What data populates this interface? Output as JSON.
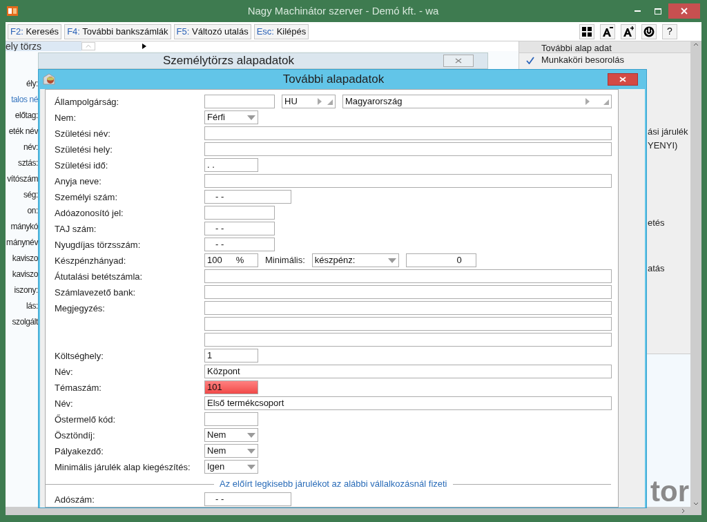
{
  "window": {
    "title": "Nagy Machinátor szerver - Demó kft. - wa"
  },
  "toolbar": [
    {
      "key": "F2:",
      "label": "Keresés"
    },
    {
      "key": "F4:",
      "label": "További bankszámlák"
    },
    {
      "key": "F5:",
      "label": "Változó utalás"
    },
    {
      "key": "Esc:",
      "label": "Kilépés"
    }
  ],
  "toolbar_icons": [
    {
      "kind": "grid"
    },
    {
      "kind": "smaller"
    },
    {
      "kind": "larger"
    },
    {
      "kind": "power"
    },
    {
      "kind": "help",
      "label": "?"
    }
  ],
  "background": {
    "tab": "ely törzs",
    "subwindow_title": "Személytörzs alapadatok",
    "labels": [
      {
        "text": "ély:",
        "kind": "plain"
      },
      {
        "text": "talos né",
        "kind": "link"
      },
      {
        "text": "előtag:",
        "kind": "plain"
      },
      {
        "text": "eték név",
        "kind": "plain"
      },
      {
        "text": "név:",
        "kind": "plain"
      },
      {
        "text": "sztás:",
        "kind": "plain"
      },
      {
        "text": "vítószám",
        "kind": "plain"
      },
      {
        "text": "ség:",
        "kind": "plain"
      },
      {
        "text": "on:",
        "kind": "plain"
      },
      {
        "text": "mánykó",
        "kind": "plain"
      },
      {
        "text": "mánynév",
        "kind": "plain"
      },
      {
        "text": "kaviszo",
        "kind": "plain"
      },
      {
        "text": "kaviszo",
        "kind": "plain"
      },
      {
        "text": "iszony:",
        "kind": "plain"
      },
      {
        "text": "lás:",
        "kind": "plain"
      },
      {
        "text": "szolgált",
        "kind": "plain"
      }
    ]
  },
  "side_panel": {
    "header": "További alap adat",
    "checked_item": {
      "text": "Munkaköri besorolás",
      "checked": true
    },
    "items": [
      {
        "text": "ási járulék"
      },
      {
        "text": "YENYI)"
      },
      {
        "text": "etés"
      },
      {
        "text": "atás"
      }
    ],
    "logo": "tor"
  },
  "dialog": {
    "title": "További alapadatok",
    "rows": [
      {
        "kind": "country",
        "label": "Állampolgárság:",
        "code": "HU",
        "country": "Magyarország",
        "invalid": false
      },
      {
        "kind": "select",
        "label": "Nem:",
        "value": "Férfi",
        "invalid": false
      },
      {
        "kind": "wide",
        "label": "Születési név:",
        "invalid": false
      },
      {
        "kind": "wide",
        "label": "Születési hely:",
        "invalid": false
      },
      {
        "kind": "short",
        "label": "Születési idő:",
        "value": ". .",
        "invalid": false
      },
      {
        "kind": "wide",
        "label": "Anyja neve:",
        "invalid": false
      },
      {
        "kind": "long",
        "label": "Személyi szám:",
        "value": "-      -",
        "invalid": false
      },
      {
        "kind": "medium",
        "label": "Adóazonosító jel:",
        "invalid": false
      },
      {
        "kind": "medium",
        "label": "TAJ szám:",
        "value": "-   -",
        "invalid": false
      },
      {
        "kind": "medium",
        "label": "Nyugdíjas törzsszám:",
        "value": "-    -",
        "invalid": false
      },
      {
        "kind": "cash",
        "label": "Készpénzhányad:",
        "value": "100",
        "unit": "%",
        "min_label": "Minimális:",
        "min_type": "készpénz:",
        "amount": "0",
        "invalid": false
      },
      {
        "kind": "wide",
        "label": "Átutalási betétszámla:",
        "invalid": false
      },
      {
        "kind": "wide",
        "label": "Számlavezető bank:",
        "invalid": false
      },
      {
        "kind": "wide",
        "label": "Megjegyzés:",
        "invalid": false
      },
      {
        "kind": "wide",
        "invalid": false
      },
      {
        "kind": "wide",
        "invalid": false
      },
      {
        "kind": "short",
        "label": "Költséghely:",
        "value": "1",
        "invalid": false
      },
      {
        "kind": "wide",
        "label": "Név:",
        "value": "Központ",
        "invalid": false
      },
      {
        "kind": "short",
        "label": "Témaszám:",
        "value": "101",
        "invalid": true
      },
      {
        "kind": "wide",
        "label": "Név:",
        "value": "Első termékcsoport",
        "invalid": false
      },
      {
        "kind": "short",
        "label": "Őstermelő kód:",
        "invalid": false
      },
      {
        "kind": "select",
        "label": "Ösztöndíj:",
        "value": "Nem",
        "invalid": false
      },
      {
        "kind": "select",
        "label": "Pályakezdő:",
        "value": "Nem",
        "invalid": false
      },
      {
        "kind": "select",
        "label": "Minimális járulék alap kiegészítés:",
        "value": "Igen",
        "invalid": false
      }
    ],
    "section": "Az előírt legkisebb járulékot az alábbi vállalkozásnál fizeti",
    "after_rows": [
      {
        "kind": "long",
        "label": "Adószám:",
        "value": "- -",
        "invalid": false
      }
    ]
  }
}
